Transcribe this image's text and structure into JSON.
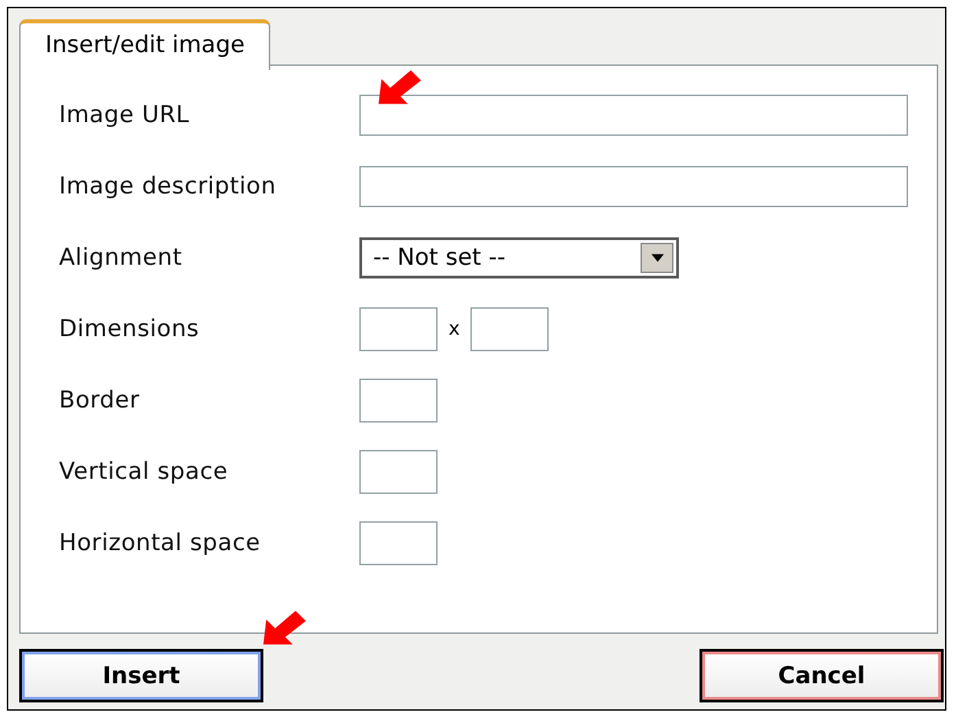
{
  "tabs": [
    {
      "label": "Insert/edit image",
      "selected": true
    }
  ],
  "fields": [
    {
      "label": "Image URL",
      "kind": "text",
      "marker": true
    },
    {
      "label": "Image description",
      "kind": "text"
    },
    {
      "label": "Alignment",
      "kind": "select",
      "value": "-- Not set --"
    },
    {
      "label": "Dimensions",
      "kind": "dimensions",
      "separator": "x"
    },
    {
      "label": "Border",
      "kind": "small"
    },
    {
      "label": "Vertical space",
      "kind": "small"
    },
    {
      "label": "Horizontal space",
      "kind": "small"
    }
  ],
  "buttons": [
    {
      "label": "Insert",
      "kind": "primary",
      "marker": true
    },
    {
      "label": "Cancel",
      "kind": "cancel"
    }
  ]
}
